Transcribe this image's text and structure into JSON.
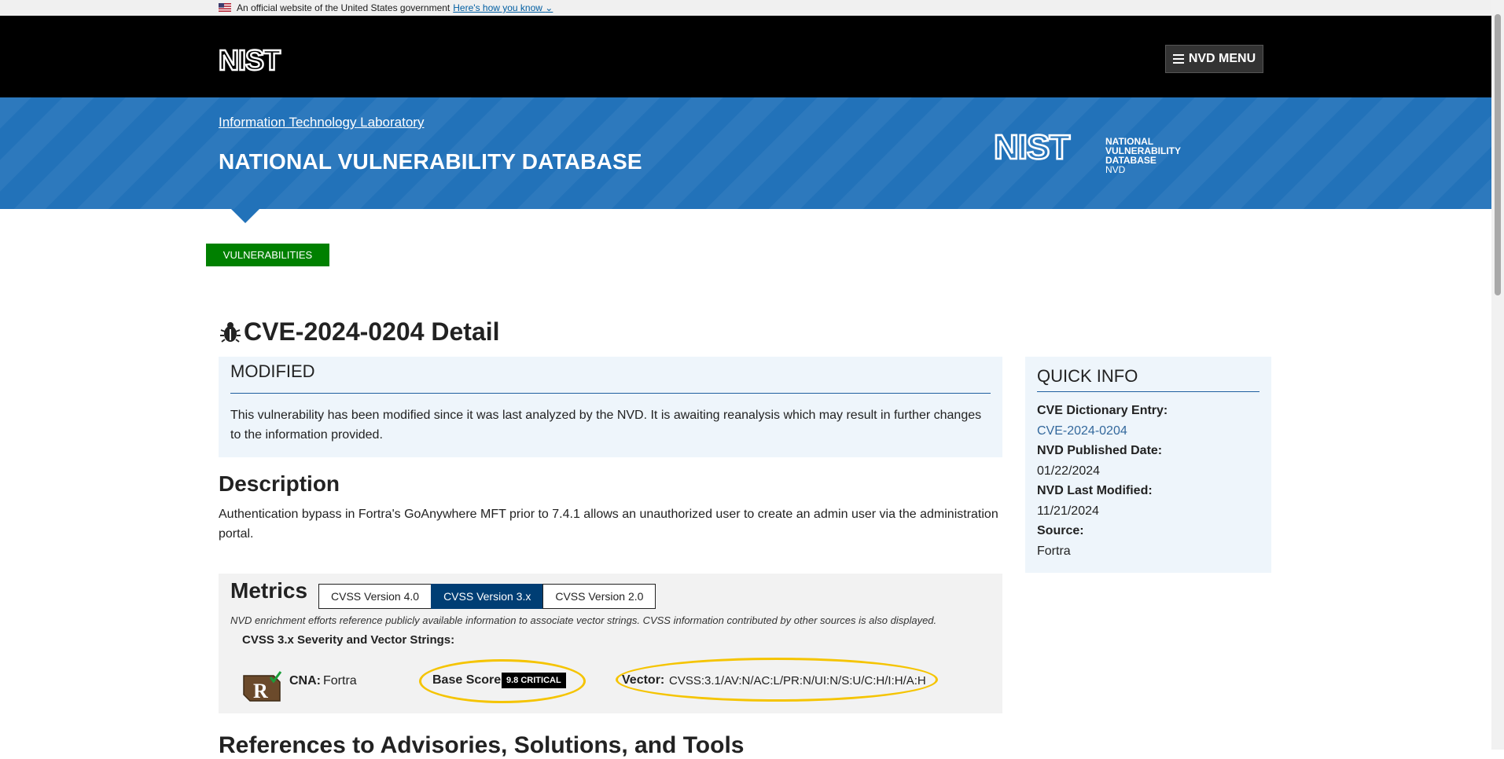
{
  "gov_banner": {
    "text": "An official website of the United States government",
    "link": "Here's how you know"
  },
  "header": {
    "logo": "NIST",
    "menu_label": "NVD MENU"
  },
  "banner": {
    "itl_link": "Information Technology Laboratory",
    "title": "NATIONAL VULNERABILITY DATABASE",
    "logo_wordmark": "NIST",
    "logo_line1": "NATIONAL VULNERABILITY",
    "logo_line2": "DATABASE",
    "logo_line3": "NVD"
  },
  "nav": {
    "vulnerabilities_tab": "VULNERABILITIES"
  },
  "cve": {
    "title": "CVE-2024-0204 Detail"
  },
  "modified": {
    "heading": "MODIFIED",
    "body": "This vulnerability has been modified since it was last analyzed by the NVD. It is awaiting reanalysis which may result in further changes to the information provided."
  },
  "description": {
    "heading": "Description",
    "text": "Authentication bypass in Fortra's GoAnywhere MFT prior to 7.4.1 allows an unauthorized user to create an admin user via the administration portal."
  },
  "metrics": {
    "heading": "Metrics",
    "tabs": [
      {
        "label": "CVSS Version 4.0",
        "active": false
      },
      {
        "label": "CVSS Version 3.x",
        "active": true
      },
      {
        "label": "CVSS Version 2.0",
        "active": false
      }
    ],
    "note": "NVD enrichment efforts reference publicly available information to associate vector strings. CVSS information contributed by other sources is also displayed.",
    "severity_heading": "CVSS 3.x Severity and Vector Strings:",
    "cna_label": "CNA:",
    "cna_value": "Fortra",
    "base_score_label": "Base Score:",
    "base_score_value": "9.8 CRITICAL",
    "vector_label": "Vector:",
    "vector_value": "CVSS:3.1/AV:N/AC:L/PR:N/UI:N/S:U/C:H/I:H/A:H",
    "highlight_color": "#f5c400"
  },
  "quick_info": {
    "heading": "QUICK INFO",
    "dictionary_label": "CVE Dictionary Entry:",
    "dictionary_value": "CVE-2024-0204",
    "published_label": "NVD Published Date:",
    "published_value": "01/22/2024",
    "modified_label": "NVD Last Modified:",
    "modified_value": "11/21/2024",
    "source_label": "Source:",
    "source_value": "Fortra"
  },
  "references": {
    "heading": "References to Advisories, Solutions, and Tools"
  },
  "colors": {
    "header_bg": "#000000",
    "banner_blue": "#2272b9",
    "tab_green": "#008000",
    "active_tab": "#003e74",
    "panel_bg": "#eef5fb"
  }
}
